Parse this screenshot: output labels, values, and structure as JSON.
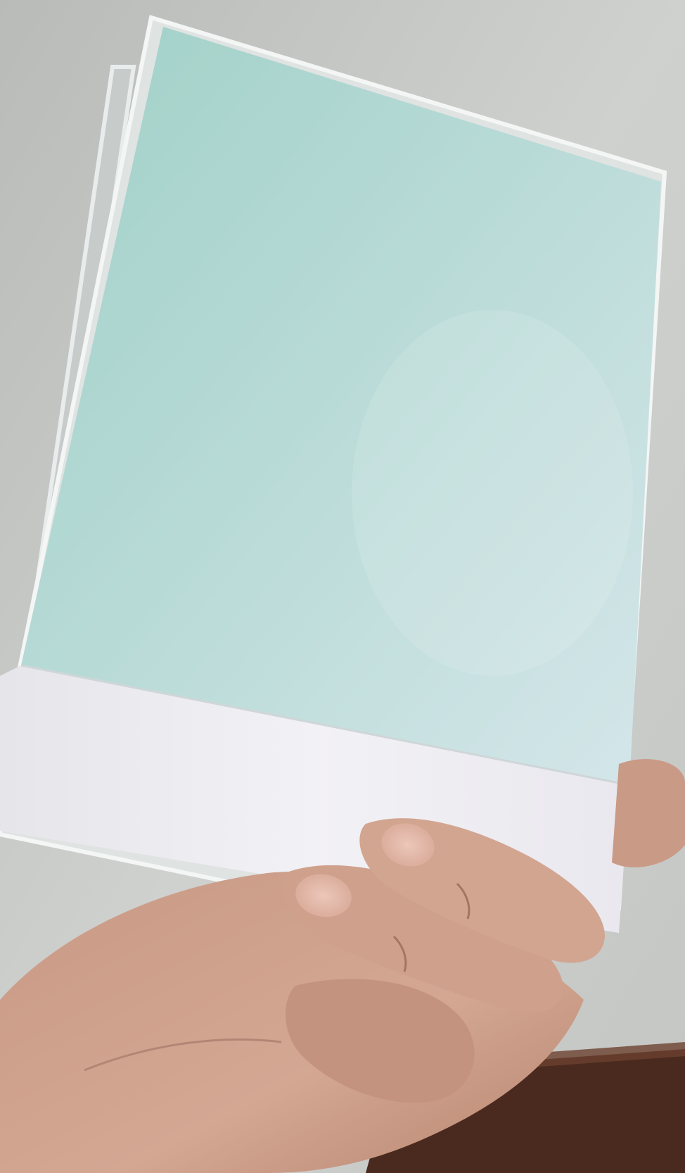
{
  "scene": {
    "subject": "notebook-held-in-hand",
    "colors": {
      "wall": "#c9cbc9",
      "wall_shadow": "#b4b6b3",
      "cover_mint": "#a8d3cc",
      "cover_light": "#cfe3e6",
      "band_white": "#ecebf0",
      "plastic_sleeve": "#d9dcdb",
      "skin": "#c99b86",
      "skin_shadow": "#9e6f5c",
      "nail": "#e2b8aa",
      "furniture_brown": "#4a2a1e"
    }
  }
}
